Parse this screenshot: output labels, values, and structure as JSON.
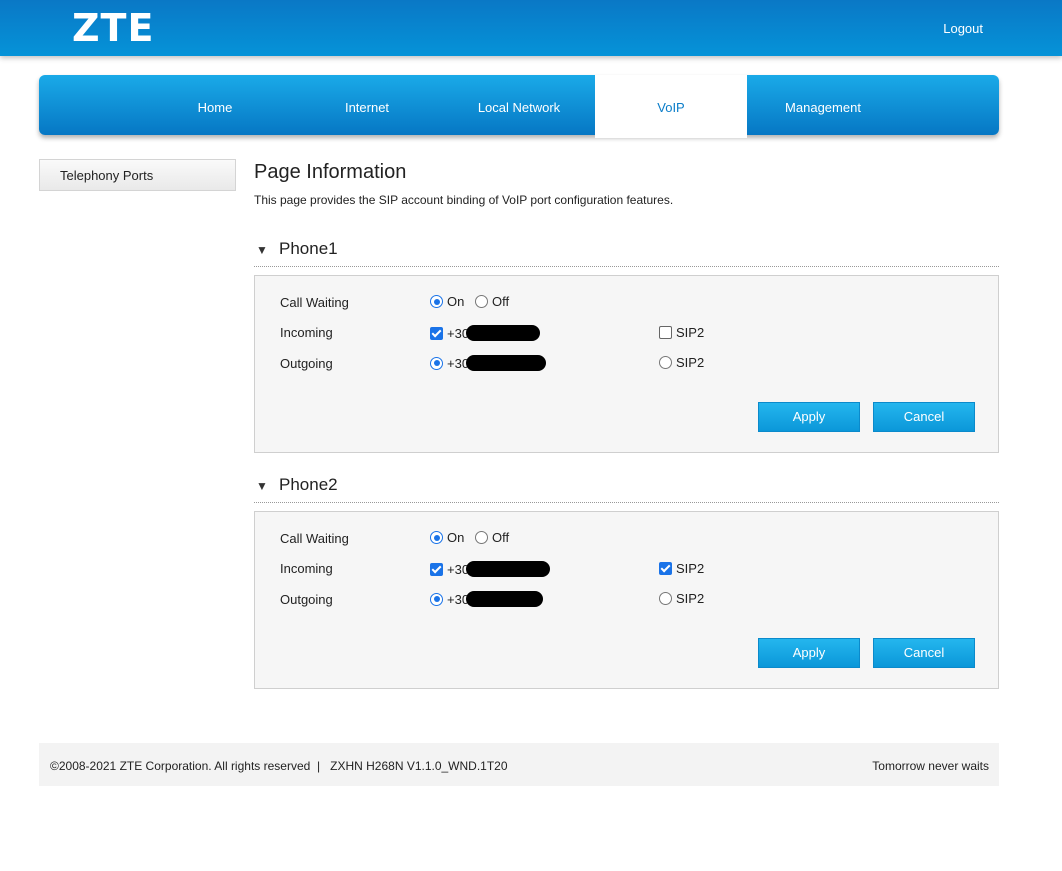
{
  "header": {
    "logo": "ZTE",
    "logout_label": "Logout"
  },
  "nav": {
    "items": [
      "Home",
      "Internet",
      "Local Network",
      "VoIP",
      "Management"
    ],
    "active": "VoIP"
  },
  "sidebar": {
    "item": "Telephony Ports"
  },
  "page": {
    "title": "Page Information",
    "description": "This page provides the SIP account binding of VoIP port configuration features."
  },
  "labels": {
    "call_waiting": "Call Waiting",
    "incoming": "Incoming",
    "outgoing": "Outgoing",
    "on": "On",
    "off": "Off",
    "sip2": "SIP2",
    "apply": "Apply",
    "cancel": "Cancel"
  },
  "phones": [
    {
      "title": "Phone1",
      "call_waiting": "On",
      "incoming_number": "+30",
      "incoming_sip1_checked": true,
      "incoming_sip2_checked": false,
      "outgoing_number": "+30",
      "outgoing_selected": "SIP1"
    },
    {
      "title": "Phone2",
      "call_waiting": "On",
      "incoming_number": "+30",
      "incoming_sip1_checked": true,
      "incoming_sip2_checked": true,
      "outgoing_number": "+30",
      "outgoing_selected": "SIP1"
    }
  ],
  "footer": {
    "copyright": "©2008-2021 ZTE Corporation. All rights reserved",
    "separator": "|",
    "version": "ZXHN H268N V1.1.0_WND.1T20",
    "slogan": "Tomorrow never waits"
  },
  "colors": {
    "header_blue": "#0593d8",
    "accent": "#1a73e8",
    "button": "#0b97d9"
  }
}
